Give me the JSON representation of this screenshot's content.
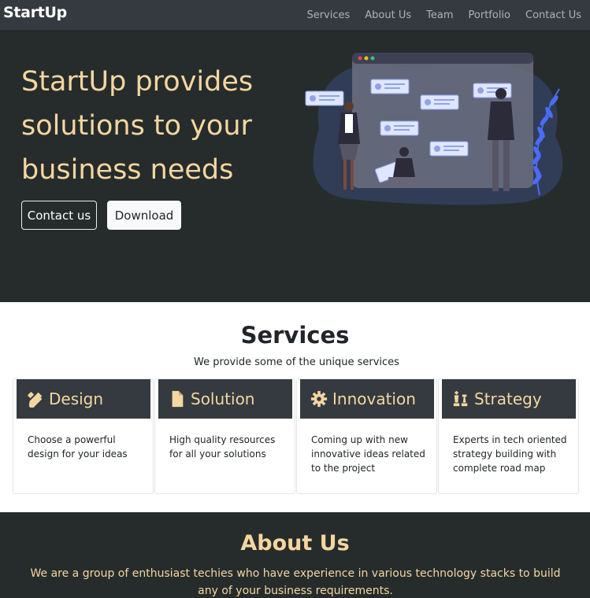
{
  "navbar": {
    "brand": "StartUp",
    "links": [
      "Services",
      "About Us",
      "Team",
      "Portfolio",
      "Contact Us"
    ]
  },
  "hero": {
    "title": "StartUp provides solutions to your business needs",
    "contact_button": "Contact us",
    "download_button": "Download"
  },
  "services": {
    "title": "Services",
    "subtitle": "We provide some of the unique services",
    "cards": [
      {
        "title": "Design",
        "icon": "pencil-ruler-icon",
        "text": "Choose a powerful design for your ideas"
      },
      {
        "title": "Solution",
        "icon": "file-icon",
        "text": "High quality resources for all your solutions"
      },
      {
        "title": "Innovation",
        "icon": "gear-icon",
        "text": "Coming up with new innovative ideas related to the project"
      },
      {
        "title": "Strategy",
        "icon": "chess-icon",
        "text": "Experts in tech oriented strategy building with complete road map"
      }
    ]
  },
  "about": {
    "title": "About Us",
    "text": "We are a group of enthusiast techies who have experience in various technology stacks to build any of your business requirements."
  },
  "colors": {
    "navbar_bg": "#343a40",
    "hero_bg": "#262c2c",
    "accent": "#f5d6a0",
    "card_head_bg": "#343a40"
  }
}
